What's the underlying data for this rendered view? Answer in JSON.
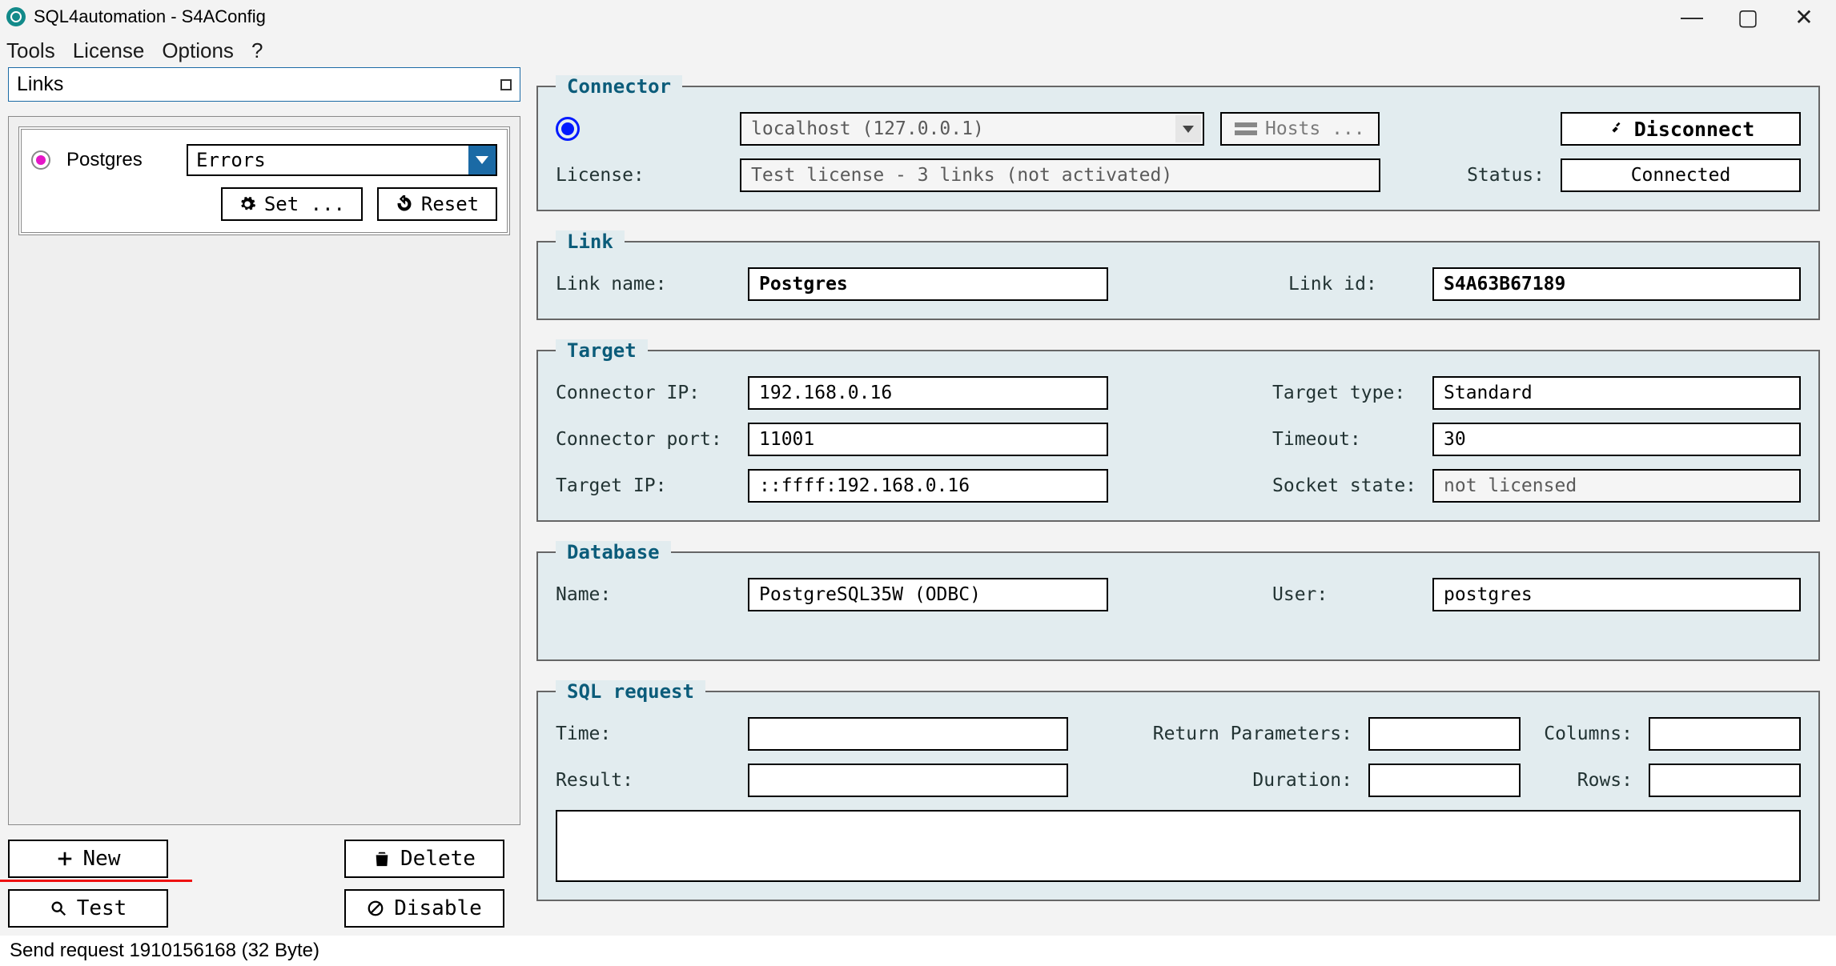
{
  "titlebar": {
    "title": "SQL4automation - S4AConfig"
  },
  "menu": {
    "tools": "Tools",
    "license": "License",
    "options": "Options",
    "help": "?"
  },
  "links_panel": {
    "title": "Links",
    "item_name": "Postgres",
    "dropdown": "Errors",
    "set_btn": "Set ...",
    "reset_btn": "Reset",
    "new_btn": "New",
    "delete_btn": "Delete",
    "test_btn": "Test",
    "disable_btn": "Disable"
  },
  "connector": {
    "legend": "Connector",
    "host": "localhost (127.0.0.1)",
    "hosts_btn": "Hosts ...",
    "disconnect_btn": "Disconnect",
    "license_label": "License:",
    "license_value": "Test license - 3 links (not activated)",
    "status_label": "Status:",
    "status_value": "Connected"
  },
  "link": {
    "legend": "Link",
    "name_label": "Link name:",
    "name_value": "Postgres",
    "id_label": "Link id:",
    "id_value": "S4A63B67189"
  },
  "target": {
    "legend": "Target",
    "conn_ip_label": "Connector IP:",
    "conn_ip": "192.168.0.16",
    "type_label": "Target type:",
    "type_value": "Standard",
    "conn_port_label": "Connector port:",
    "conn_port": "11001",
    "timeout_label": "Timeout:",
    "timeout_value": "30",
    "target_ip_label": "Target IP:",
    "target_ip": "::ffff:192.168.0.16",
    "socket_label": "Socket state:",
    "socket_value": "not licensed"
  },
  "database": {
    "legend": "Database",
    "name_label": "Name:",
    "name_value": "PostgreSQL35W (ODBC)",
    "user_label": "User:",
    "user_value": "postgres"
  },
  "sql": {
    "legend": "SQL request",
    "time_label": "Time:",
    "time_value": "",
    "retparam_label": "Return Parameters:",
    "retparam_value": "",
    "columns_label": "Columns:",
    "columns_value": "",
    "result_label": "Result:",
    "result_value": "",
    "duration_label": "Duration:",
    "duration_value": "",
    "rows_label": "Rows:",
    "rows_value": ""
  },
  "statusbar": "Send request 1910156168 (32 Byte)"
}
